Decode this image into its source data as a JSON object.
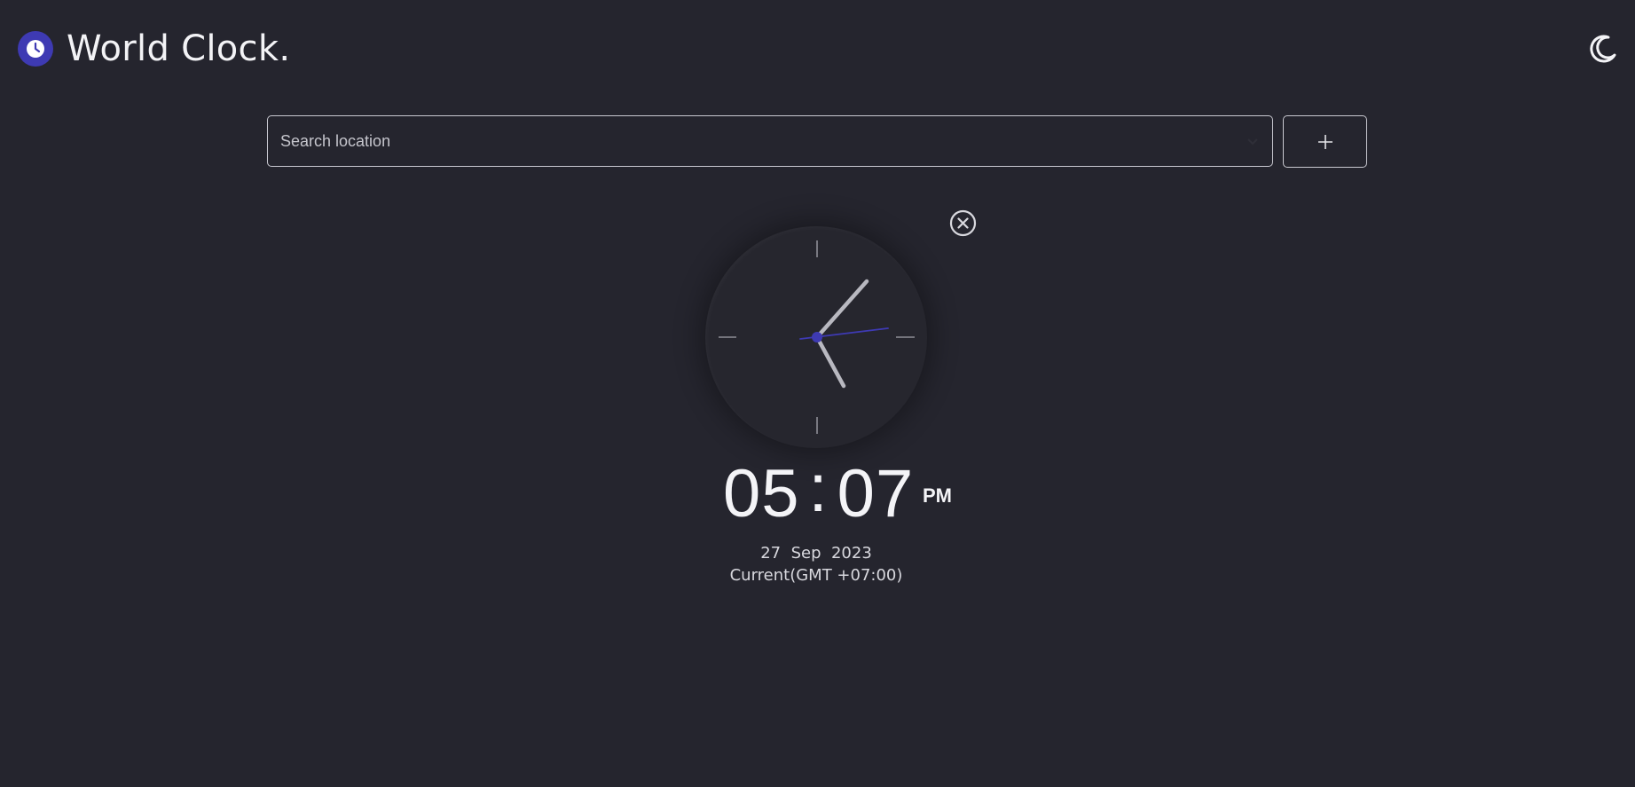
{
  "header": {
    "title": "World Clock.",
    "logo_icon": "clock-icon",
    "theme_toggle_icon": "moon-icon"
  },
  "search": {
    "placeholder": "Search location",
    "value": "",
    "dropdown_icon": "chevron-down-icon"
  },
  "add_button": {
    "icon": "plus-icon"
  },
  "clock_card": {
    "remove_icon": "close-circle-icon",
    "hour": "05",
    "separator": ":",
    "minute": "07",
    "ampm": "PM",
    "day": "27",
    "month": "Sep",
    "year": "2023",
    "zone_label": "Current(GMT +07:00)"
  },
  "colors": {
    "background": "#25252e",
    "accent": "#3e3ab3",
    "text": "#f4f4f7",
    "border": "#c9c9d1"
  }
}
